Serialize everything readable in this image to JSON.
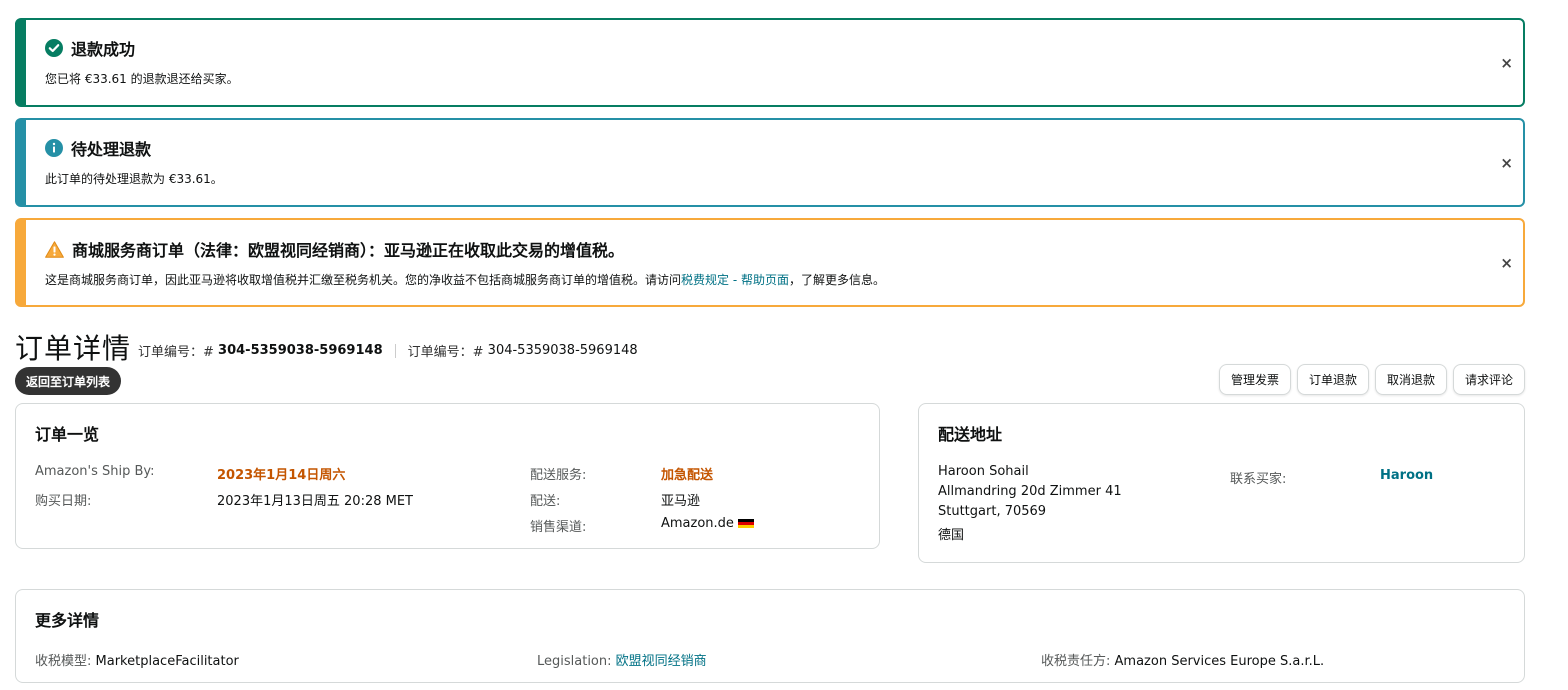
{
  "alerts": {
    "success": {
      "title": "退款成功",
      "message": "您已将 €33.61 的退款退还给买家。",
      "icon": "check-circle-icon",
      "color": "#067d62"
    },
    "info": {
      "title": "待处理退款",
      "message": "此订单的待处理退款为 €33.61。",
      "icon": "info-icon",
      "color": "#2590a6"
    },
    "warning": {
      "title": "商城服务商订单（法律：欧盟视同经销商）：亚马逊正在收取此交易的增值税。",
      "message_prefix": "这是商城服务商订单，因此亚马逊将收取增值税并汇缴至税务机关。您的净收益不包括商城服务商订单的增值税。请访问",
      "link_text": "税费规定 - 帮助页面",
      "message_suffix": "，了解更多信息。",
      "icon": "warning-icon",
      "color": "#f7a93b"
    },
    "close_glyph": "×"
  },
  "header": {
    "page_title": "订单详情",
    "order_id_label": "订单编号：#",
    "order_id_value": "304-5359038-5969148",
    "order_id_label2": "订单编号：#",
    "order_id_value2": "304-5359038-5969148",
    "back_button": "返回至订单列表"
  },
  "actions": {
    "manage_invoice": "管理发票",
    "refund_order": "订单退款",
    "cancel_refund": "取消退款",
    "request_review": "请求评论"
  },
  "summary": {
    "title": "订单一览",
    "ship_by_label": "Amazon's Ship By:",
    "ship_by_value": "2023年1月14日周六",
    "purchase_date_label": "购买日期:",
    "purchase_date_value": "2023年1月13日周五 20:28 MET",
    "shipping_service_label": "配送服务:",
    "shipping_service_value": "加急配送",
    "fulfillment_label": "配送:",
    "fulfillment_value": "亚马逊",
    "channel_label": "销售渠道:",
    "channel_value": "Amazon.de",
    "flag_icon": "germany-flag-icon"
  },
  "address": {
    "title": "配送地址",
    "name": "Haroon Sohail",
    "line1": "Allmandring 20d Zimmer 41",
    "line2": "Stuttgart, 70569",
    "country": "德国",
    "contact_label": "联系买家:",
    "contact_value": "Haroon"
  },
  "more": {
    "title": "更多详情",
    "tax_model_label": "收税模型:",
    "tax_model_value": "MarketplaceFacilitator",
    "legislation_label": "Legislation:",
    "legislation_value": "欧盟视同经销商",
    "tax_party_label": "收税责任方:",
    "tax_party_value": "Amazon Services Europe S.a.r.L."
  }
}
